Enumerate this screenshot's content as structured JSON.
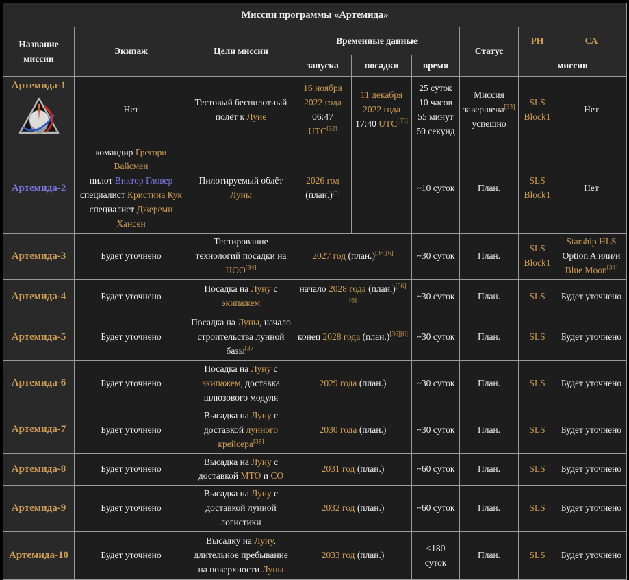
{
  "title": "Миссии программы «Артемида»",
  "colors": {
    "gold_link": "#cf9c55",
    "visited_link": "#7f76e2",
    "text": "#ececec",
    "th_bg": "#292929",
    "td_bg": "#1d1d1d",
    "border": "#9a9a9a"
  },
  "header": {
    "name": "Название миссии",
    "crew": "Экипаж",
    "goals": "Цели миссии",
    "time_data": "Временные данные",
    "status": "Статус",
    "rn": "РН",
    "ca": "СА",
    "launch": "запуска",
    "landing": "посадки",
    "duration": "время",
    "missions": "миссии"
  },
  "icons": {
    "artemis1_patch": "artemis-triangle-logo"
  },
  "rows": [
    {
      "h": 90,
      "cells": [
        {
          "th": true,
          "name": "mission-name-cell",
          "logo": true,
          "segments": [
            {
              "t": "Артемида-1",
              "c": "g"
            }
          ]
        },
        {
          "name": "crew-cell",
          "segments": [
            {
              "t": "Нет"
            }
          ]
        },
        {
          "name": "goals-cell",
          "segments": [
            {
              "t": "Тестовый беспилотный полёт к "
            },
            {
              "t": "Луне",
              "c": "g"
            }
          ]
        },
        {
          "name": "launch-cell",
          "segments": [
            {
              "t": "16 ноября 2022 года",
              "c": "g"
            },
            {
              "t": " 06:47 "
            },
            {
              "t": "UTC",
              "c": "g"
            },
            {
              "t": "[32]",
              "sup": true
            }
          ]
        },
        {
          "name": "landing-cell",
          "segments": [
            {
              "t": "11 декабря 2022 года",
              "c": "g"
            },
            {
              "t": " 17:40 "
            },
            {
              "t": "UTC",
              "c": "g"
            },
            {
              "t": "[33]",
              "sup": true
            }
          ]
        },
        {
          "name": "duration-cell",
          "segments": [
            {
              "t": "25 суток 10 часов 55 минут 50 секунд"
            }
          ]
        },
        {
          "name": "status-cell",
          "segments": [
            {
              "t": "Миссия завершена"
            },
            {
              "t": "[33]",
              "sup": true
            },
            {
              "t": " успешно"
            }
          ]
        },
        {
          "name": "rocket-cell",
          "segments": [
            {
              "t": "SLS Block1",
              "c": "g"
            }
          ]
        },
        {
          "name": "lander-cell",
          "segments": [
            {
              "t": "Нет"
            }
          ]
        }
      ]
    },
    {
      "h": 90,
      "cells": [
        {
          "th": true,
          "name": "mission-name-cell",
          "segments": [
            {
              "t": "Артемида-2",
              "c": "v"
            }
          ]
        },
        {
          "name": "crew-cell",
          "segments": [
            {
              "t": "командир "
            },
            {
              "t": "Грегори Вайсмен",
              "c": "g"
            },
            {
              "br": true
            },
            {
              "t": "пилот "
            },
            {
              "t": "Виктор Гловер",
              "c": "v"
            },
            {
              "br": true
            },
            {
              "t": "специалист "
            },
            {
              "t": "Кристина Кук",
              "c": "g"
            },
            {
              "br": true
            },
            {
              "t": "специалист "
            },
            {
              "t": "Джереми Хансен",
              "c": "g"
            }
          ]
        },
        {
          "name": "goals-cell",
          "segments": [
            {
              "t": "Пилотируемый облёт "
            },
            {
              "t": "Луны",
              "c": "g"
            }
          ]
        },
        {
          "name": "launch-cell",
          "segments": [
            {
              "t": "2026 год",
              "c": "g"
            },
            {
              "br": true
            },
            {
              "t": "(план.)"
            },
            {
              "t": "[5]",
              "sup": true
            }
          ]
        },
        {
          "name": "landing-cell",
          "segments": []
        },
        {
          "name": "duration-cell",
          "segments": [
            {
              "t": "~10 суток"
            }
          ]
        },
        {
          "name": "status-cell",
          "segments": [
            {
              "t": "План."
            }
          ]
        },
        {
          "name": "rocket-cell",
          "segments": [
            {
              "t": "SLS Block1",
              "c": "g"
            }
          ]
        },
        {
          "name": "lander-cell",
          "segments": [
            {
              "t": "Нет"
            }
          ]
        }
      ]
    },
    {
      "h": 62,
      "cells": [
        {
          "th": true,
          "name": "mission-name-cell",
          "segments": [
            {
              "t": "Артемида-3",
              "c": "g"
            }
          ]
        },
        {
          "name": "crew-cell",
          "segments": [
            {
              "t": "Будет уточнено"
            }
          ]
        },
        {
          "name": "goals-cell",
          "segments": [
            {
              "t": "Тестирование технологий посадки на "
            },
            {
              "t": "НОО",
              "c": "g"
            },
            {
              "t": "[34]",
              "sup": true
            }
          ]
        },
        {
          "name": "launch-cell",
          "colspan": 2,
          "segments": [
            {
              "t": "2027 год",
              "c": "g"
            },
            {
              "t": " (план.)"
            },
            {
              "t": "[35][6]",
              "sup": true
            }
          ]
        },
        {
          "name": "duration-cell",
          "segments": [
            {
              "t": "~30 суток"
            }
          ]
        },
        {
          "name": "status-cell",
          "segments": [
            {
              "t": "План."
            }
          ]
        },
        {
          "name": "rocket-cell",
          "segments": [
            {
              "t": "SLS Block1",
              "c": "g"
            }
          ]
        },
        {
          "name": "lander-cell",
          "segments": [
            {
              "t": "Starship HLS",
              "c": "g"
            },
            {
              "t": " Option A или/и "
            },
            {
              "t": "Blue Moon",
              "c": "g"
            },
            {
              "t": "[34]",
              "sup": true
            }
          ]
        }
      ]
    },
    {
      "h": 50,
      "cells": [
        {
          "th": true,
          "name": "mission-name-cell",
          "segments": [
            {
              "t": "Артемида-4",
              "c": "g"
            }
          ]
        },
        {
          "name": "crew-cell",
          "segments": [
            {
              "t": "Будет уточнено"
            }
          ]
        },
        {
          "name": "goals-cell",
          "segments": [
            {
              "t": "Посадка на "
            },
            {
              "t": "Луну",
              "c": "g"
            },
            {
              "t": " с "
            },
            {
              "t": "экипажем",
              "c": "g"
            }
          ]
        },
        {
          "name": "launch-cell",
          "colspan": 2,
          "segments": [
            {
              "t": "начало "
            },
            {
              "t": "2028 года",
              "c": "g"
            },
            {
              "t": " (план.)"
            },
            {
              "t": "[36][6]",
              "sup": true
            }
          ]
        },
        {
          "name": "duration-cell",
          "segments": [
            {
              "t": "~30 суток"
            }
          ]
        },
        {
          "name": "status-cell",
          "segments": [
            {
              "t": "План."
            }
          ]
        },
        {
          "name": "rocket-cell",
          "segments": [
            {
              "t": "SLS",
              "c": "g"
            }
          ]
        },
        {
          "name": "lander-cell",
          "segments": [
            {
              "t": "Будет уточнено"
            }
          ]
        }
      ]
    },
    {
      "h": 66,
      "cells": [
        {
          "th": true,
          "name": "mission-name-cell",
          "segments": [
            {
              "t": "Артемида-5",
              "c": "g"
            }
          ]
        },
        {
          "name": "crew-cell",
          "segments": [
            {
              "t": "Будет уточнено"
            }
          ]
        },
        {
          "name": "goals-cell",
          "segments": [
            {
              "t": "Посадка на "
            },
            {
              "t": "Луны",
              "c": "g"
            },
            {
              "t": ", начало строительства лунной базы"
            },
            {
              "t": "[37]",
              "sup": true
            }
          ]
        },
        {
          "name": "launch-cell",
          "colspan": 2,
          "segments": [
            {
              "t": "конец "
            },
            {
              "t": "2028 года",
              "c": "g"
            },
            {
              "t": " (план.)"
            },
            {
              "t": "[36][6]",
              "sup": true
            }
          ]
        },
        {
          "name": "duration-cell",
          "segments": [
            {
              "t": "~30 суток"
            }
          ]
        },
        {
          "name": "status-cell",
          "segments": [
            {
              "t": "План."
            }
          ]
        },
        {
          "name": "rocket-cell",
          "segments": [
            {
              "t": "SLS",
              "c": "g"
            }
          ]
        },
        {
          "name": "lander-cell",
          "segments": [
            {
              "t": "Будет уточнено"
            }
          ]
        }
      ]
    },
    {
      "h": 68,
      "cells": [
        {
          "th": true,
          "name": "mission-name-cell",
          "segments": [
            {
              "t": "Артемида-6",
              "c": "g"
            }
          ]
        },
        {
          "name": "crew-cell",
          "segments": [
            {
              "t": "Будет уточнено"
            }
          ]
        },
        {
          "name": "goals-cell",
          "segments": [
            {
              "t": "Посадка на "
            },
            {
              "t": "Луну",
              "c": "g"
            },
            {
              "t": " с "
            },
            {
              "t": "экипажем",
              "c": "g"
            },
            {
              "t": ", доставка шлюзового модуля"
            }
          ]
        },
        {
          "name": "launch-cell",
          "colspan": 2,
          "segments": [
            {
              "t": "2029 года",
              "c": "g"
            },
            {
              "t": " (план.)"
            }
          ]
        },
        {
          "name": "duration-cell",
          "segments": [
            {
              "t": "~30 суток"
            }
          ]
        },
        {
          "name": "status-cell",
          "segments": [
            {
              "t": "План."
            }
          ]
        },
        {
          "name": "rocket-cell",
          "segments": [
            {
              "t": "SLS",
              "c": "g"
            }
          ]
        },
        {
          "name": "lander-cell",
          "segments": [
            {
              "t": "Будет уточнено"
            }
          ]
        }
      ]
    },
    {
      "h": 68,
      "cells": [
        {
          "th": true,
          "name": "mission-name-cell",
          "segments": [
            {
              "t": "Артемида-7",
              "c": "g"
            }
          ]
        },
        {
          "name": "crew-cell",
          "segments": [
            {
              "t": "Будет уточнено"
            }
          ]
        },
        {
          "name": "goals-cell",
          "segments": [
            {
              "t": "Высадка на "
            },
            {
              "t": "Луну",
              "c": "g"
            },
            {
              "t": " с доставкой "
            },
            {
              "t": "лунного крейсера",
              "c": "g"
            },
            {
              "t": "[38]",
              "sup": true
            }
          ]
        },
        {
          "name": "launch-cell",
          "colspan": 2,
          "segments": [
            {
              "t": "2030 года",
              "c": "g"
            },
            {
              "t": " (план.)"
            }
          ]
        },
        {
          "name": "duration-cell",
          "segments": [
            {
              "t": "~30 суток"
            }
          ]
        },
        {
          "name": "status-cell",
          "segments": [
            {
              "t": "План."
            }
          ]
        },
        {
          "name": "rocket-cell",
          "segments": [
            {
              "t": "SLS",
              "c": "g"
            }
          ]
        },
        {
          "name": "lander-cell",
          "segments": [
            {
              "t": "Будет уточнено"
            }
          ]
        }
      ]
    },
    {
      "h": 46,
      "cells": [
        {
          "th": true,
          "name": "mission-name-cell",
          "segments": [
            {
              "t": "Артемида-8",
              "c": "g"
            }
          ]
        },
        {
          "name": "crew-cell",
          "segments": [
            {
              "t": "Будет уточнено"
            }
          ]
        },
        {
          "name": "goals-cell",
          "segments": [
            {
              "t": "Высадка на "
            },
            {
              "t": "Луну",
              "c": "g"
            },
            {
              "t": " с доставкой "
            },
            {
              "t": "МТО",
              "c": "g"
            },
            {
              "t": " и "
            },
            {
              "t": "СО",
              "c": "g"
            }
          ]
        },
        {
          "name": "launch-cell",
          "colspan": 2,
          "segments": [
            {
              "t": "2031 год",
              "c": "g"
            },
            {
              "t": " (план.)"
            }
          ]
        },
        {
          "name": "duration-cell",
          "segments": [
            {
              "t": "~60 суток"
            }
          ]
        },
        {
          "name": "status-cell",
          "segments": [
            {
              "t": "План."
            }
          ]
        },
        {
          "name": "rocket-cell",
          "segments": [
            {
              "t": "SLS",
              "c": "g"
            }
          ]
        },
        {
          "name": "lander-cell",
          "segments": [
            {
              "t": "Будет уточнено"
            }
          ]
        }
      ]
    },
    {
      "h": 64,
      "cells": [
        {
          "th": true,
          "name": "mission-name-cell",
          "segments": [
            {
              "t": "Артемида-9",
              "c": "g"
            }
          ]
        },
        {
          "name": "crew-cell",
          "segments": [
            {
              "t": "Будет уточнено"
            }
          ]
        },
        {
          "name": "goals-cell",
          "segments": [
            {
              "t": "Высадка на "
            },
            {
              "t": "Луну",
              "c": "g"
            },
            {
              "t": " с доставкой лунной логистики"
            }
          ]
        },
        {
          "name": "launch-cell",
          "colspan": 2,
          "segments": [
            {
              "t": "2032 год",
              "c": "g"
            },
            {
              "t": " (план.)"
            }
          ]
        },
        {
          "name": "duration-cell",
          "segments": [
            {
              "t": "~60 суток"
            }
          ]
        },
        {
          "name": "status-cell",
          "segments": [
            {
              "t": "План."
            }
          ]
        },
        {
          "name": "rocket-cell",
          "segments": [
            {
              "t": "SLS",
              "c": "g"
            }
          ]
        },
        {
          "name": "lander-cell",
          "segments": [
            {
              "t": "Будет уточнено"
            }
          ]
        }
      ]
    },
    {
      "h": 70,
      "cells": [
        {
          "th": true,
          "name": "mission-name-cell",
          "segments": [
            {
              "t": "Артемида-10",
              "c": "g"
            }
          ]
        },
        {
          "name": "crew-cell",
          "segments": [
            {
              "t": "Будет уточнено"
            }
          ]
        },
        {
          "name": "goals-cell",
          "segments": [
            {
              "t": "Высадку на "
            },
            {
              "t": "Луну",
              "c": "g"
            },
            {
              "t": ", длительное пребывание на поверхности "
            },
            {
              "t": "Луны",
              "c": "g"
            }
          ]
        },
        {
          "name": "launch-cell",
          "colspan": 2,
          "segments": [
            {
              "t": "2033 год",
              "c": "g"
            },
            {
              "t": " (план.)"
            }
          ]
        },
        {
          "name": "duration-cell",
          "segments": [
            {
              "t": "<180 суток"
            }
          ]
        },
        {
          "name": "status-cell",
          "segments": [
            {
              "t": "План."
            }
          ]
        },
        {
          "name": "rocket-cell",
          "segments": [
            {
              "t": "SLS",
              "c": "g"
            }
          ]
        },
        {
          "name": "lander-cell",
          "segments": [
            {
              "t": "Будет уточнено"
            }
          ]
        }
      ]
    }
  ]
}
